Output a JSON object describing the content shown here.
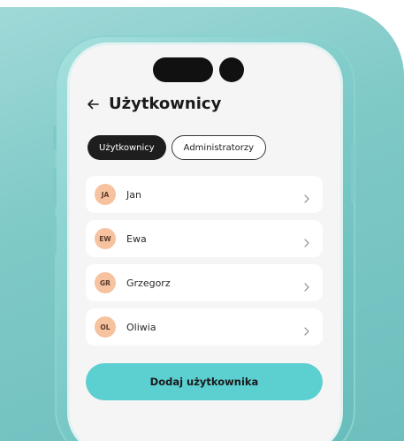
{
  "colors": {
    "accent": "#5ccfd1",
    "avatar_bg": "#f6c29f",
    "tab_active_bg": "#1e1e1e",
    "background_card": "#7fc9c7"
  },
  "header": {
    "back_icon": "arrow-left-icon",
    "title": "Użytkownicy"
  },
  "tabs": [
    {
      "label": "Użytkownicy",
      "active": true
    },
    {
      "label": "Administratorzy",
      "active": false
    }
  ],
  "users": [
    {
      "initials": "JA",
      "name": "Jan"
    },
    {
      "initials": "EW",
      "name": "Ewa"
    },
    {
      "initials": "GR",
      "name": "Grzegorz"
    },
    {
      "initials": "OL",
      "name": "Oliwia"
    }
  ],
  "row_icon": "chevron-right-icon",
  "add_button": {
    "label": "Dodaj użytkownika"
  }
}
